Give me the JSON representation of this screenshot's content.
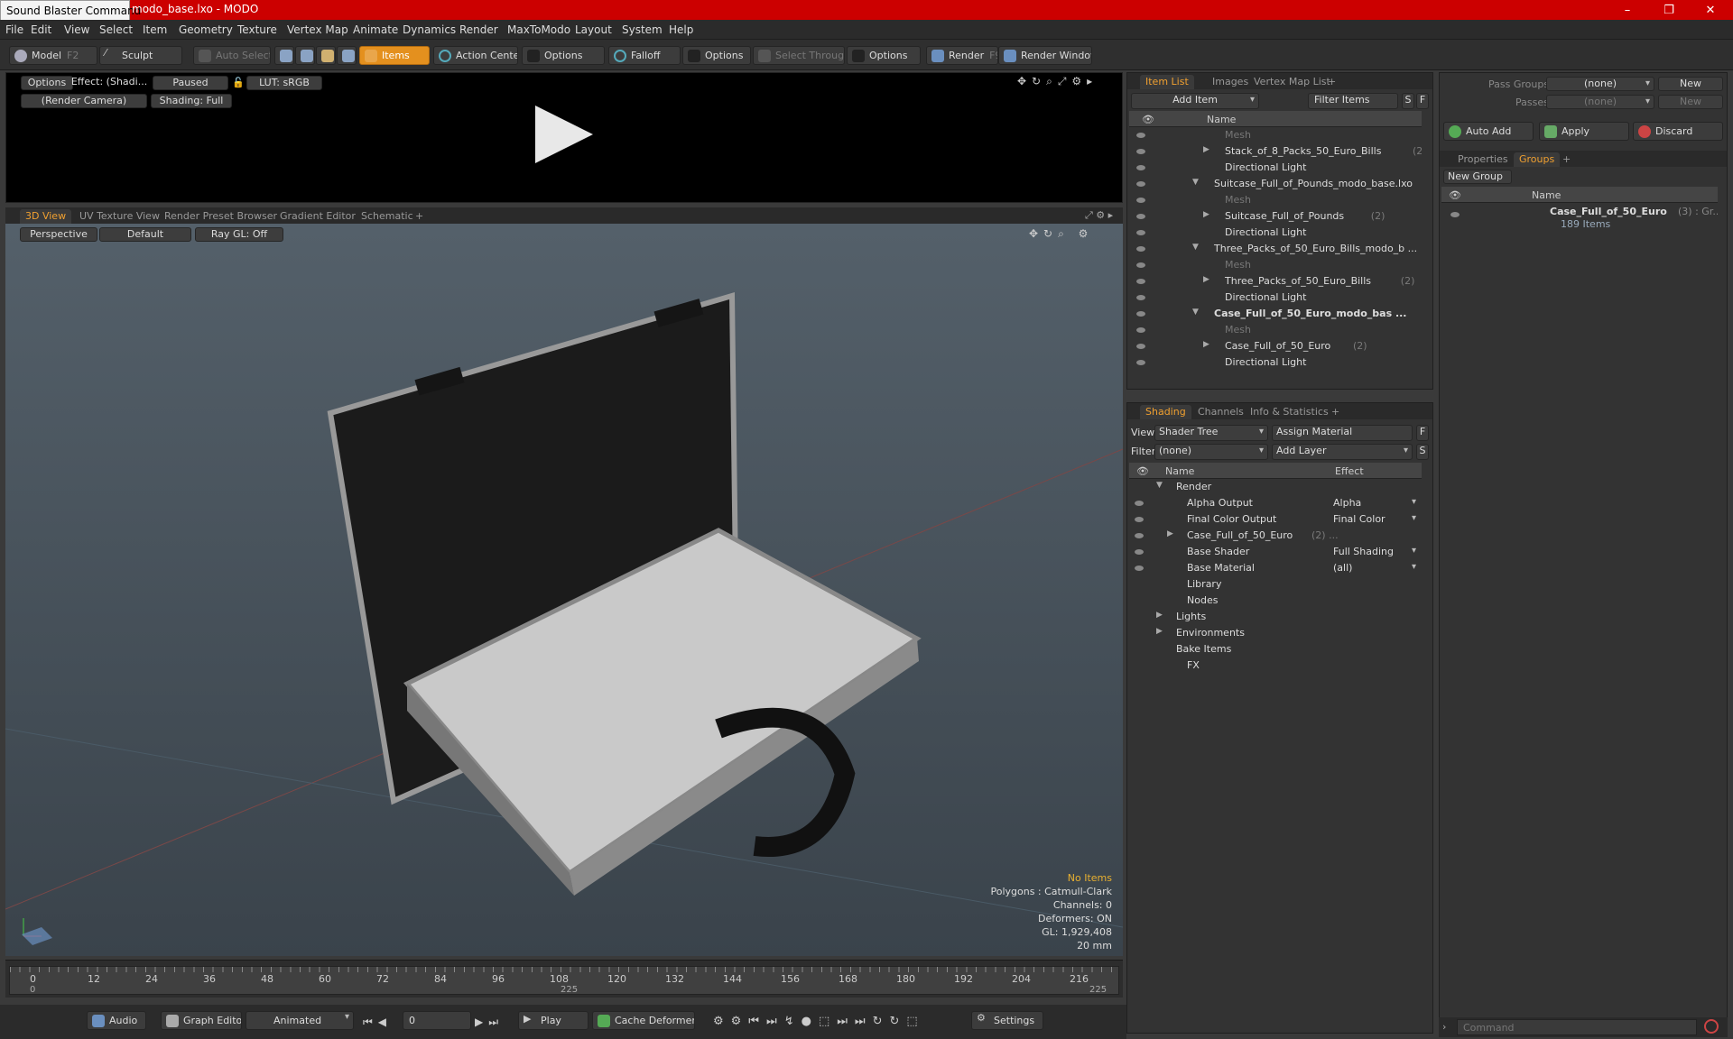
{
  "window": {
    "title": "modo_base.lxo - MODO",
    "tooltip": "Sound Blaster Command",
    "minimize": "–",
    "maximize": "❐",
    "close": "✕"
  },
  "menu": [
    "File",
    "Edit",
    "View",
    "Select",
    "Item",
    "Geometry",
    "Texture",
    "Vertex Map",
    "Animate",
    "Dynamics",
    "Render",
    "MaxToModo",
    "Layout",
    "System",
    "Help"
  ],
  "toolbar": {
    "model": "Model",
    "model_key": "F2",
    "sculpt": "Sculpt",
    "auto_select": "Auto Select",
    "items": "Items",
    "action_center": "Action Center",
    "options1": "Options",
    "falloff": "Falloff",
    "options2": "Options",
    "select_through": "Select Through",
    "options3": "Options",
    "render": "Render",
    "render_key": "F9",
    "render_window": "Render Window"
  },
  "preview": {
    "options": "Options",
    "effect": "Effect: (Shadi...",
    "paused": "Paused",
    "lut": "LUT: sRGB",
    "camera": "(Render Camera)",
    "shading": "Shading: Full"
  },
  "viewport": {
    "tabs": [
      "3D View",
      "UV Texture View",
      "Render Preset Browser",
      "Gradient Editor",
      "Schematic",
      "+"
    ],
    "perspective": "Perspective",
    "default": "Default",
    "raygl": "Ray GL: Off",
    "info": {
      "no_items": "No Items",
      "polygons": "Polygons : Catmull-Clark",
      "channels": "Channels: 0",
      "deformers": "Deformers: ON",
      "gl": "GL: 1,929,408",
      "scale": "20 mm"
    }
  },
  "timeline": {
    "ticks": [
      "0",
      "12",
      "24",
      "36",
      "48",
      "60",
      "72",
      "84",
      "96",
      "108",
      "120",
      "132",
      "144",
      "156",
      "168",
      "180",
      "192",
      "204",
      "216"
    ],
    "start": "0",
    "mid": "225",
    "end": "225"
  },
  "bottombar": {
    "audio": "Audio",
    "graph_editor": "Graph Editor",
    "animated": "Animated",
    "frame": "0",
    "play": "Play",
    "cache": "Cache Deformers",
    "settings": "Settings"
  },
  "itemlist": {
    "tabs": [
      "Item List",
      "Images",
      "Vertex Map List",
      "+"
    ],
    "add_item": "Add Item",
    "filter": "Filter Items",
    "s": "S",
    "f": "F",
    "name_col": "Name",
    "rows": [
      {
        "indent": 1,
        "label": "Mesh",
        "dim": true,
        "arrow": ""
      },
      {
        "indent": 1,
        "label": "Stack_of_8_Packs_50_Euro_Bills",
        "count": "(2)",
        "arrow": "▶"
      },
      {
        "indent": 1,
        "label": "Directional Light",
        "arrow": ""
      },
      {
        "indent": 0,
        "label": "Suitcase_Full_of_Pounds_modo_base.lxo",
        "arrow": "▼"
      },
      {
        "indent": 1,
        "label": "Mesh",
        "dim": true,
        "arrow": ""
      },
      {
        "indent": 1,
        "label": "Suitcase_Full_of_Pounds",
        "count": "(2)",
        "arrow": "▶"
      },
      {
        "indent": 1,
        "label": "Directional Light",
        "arrow": ""
      },
      {
        "indent": 0,
        "label": "Three_Packs_of_50_Euro_Bills_modo_b ...",
        "arrow": "▼"
      },
      {
        "indent": 1,
        "label": "Mesh",
        "dim": true,
        "arrow": ""
      },
      {
        "indent": 1,
        "label": "Three_Packs_of_50_Euro_Bills",
        "count": "(2)",
        "arrow": "▶"
      },
      {
        "indent": 1,
        "label": "Directional Light",
        "arrow": ""
      },
      {
        "indent": 0,
        "label": "Case_Full_of_50_Euro_modo_bas ...",
        "bold": true,
        "arrow": "▼"
      },
      {
        "indent": 1,
        "label": "Mesh",
        "dim": true,
        "arrow": ""
      },
      {
        "indent": 1,
        "label": "Case_Full_of_50_Euro",
        "count": "(2)",
        "arrow": "▶"
      },
      {
        "indent": 1,
        "label": "Directional Light",
        "arrow": ""
      }
    ]
  },
  "shading": {
    "tabs": [
      "Shading",
      "Channels",
      "Info & Statistics",
      "+"
    ],
    "view_label": "View",
    "view_value": "Shader Tree",
    "assign": "Assign Material",
    "f": "F",
    "filter_label": "Filter",
    "filter_value": "(none)",
    "add_layer": "Add Layer",
    "s": "S",
    "name_col": "Name",
    "effect_col": "Effect",
    "rows": [
      {
        "indent": 0,
        "label": "Render",
        "effect": "",
        "arrow": "▼",
        "eye": false
      },
      {
        "indent": 1,
        "label": "Alpha Output",
        "effect": "Alpha",
        "eye": true
      },
      {
        "indent": 1,
        "label": "Final Color Output",
        "effect": "Final Color",
        "eye": true
      },
      {
        "indent": 1,
        "label": "Case_Full_of_50_Euro",
        "count": "(2) ...",
        "effect": "",
        "arrow": "▶",
        "eye": true
      },
      {
        "indent": 1,
        "label": "Base Shader",
        "effect": "Full Shading",
        "eye": true
      },
      {
        "indent": 1,
        "label": "Base Material",
        "effect": "(all)",
        "eye": true
      },
      {
        "indent": 1,
        "label": "Library",
        "effect": "",
        "eye": false
      },
      {
        "indent": 1,
        "label": "Nodes",
        "effect": "",
        "eye": false
      },
      {
        "indent": 0,
        "label": "Lights",
        "effect": "",
        "arrow": "▶",
        "eye": false
      },
      {
        "indent": 0,
        "label": "Environments",
        "effect": "",
        "arrow": "▶",
        "eye": false
      },
      {
        "indent": 0,
        "label": "Bake Items",
        "effect": "",
        "eye": false
      },
      {
        "indent": 1,
        "label": "FX",
        "effect": "",
        "eye": false
      }
    ]
  },
  "groups": {
    "pass_groups": "Pass Groups",
    "pass_value": "(none)",
    "new": "New",
    "passes": "Passes",
    "passes_value": "(none)",
    "new2": "New",
    "auto_add": "Auto Add",
    "apply": "Apply",
    "discard": "Discard",
    "tabs": [
      "Properties",
      "Groups",
      "+"
    ],
    "new_group": "New Group",
    "name_col": "Name",
    "item_name": "Case_Full_of_50_Euro",
    "item_count": "(3) : Gr...",
    "item_sub": "189 Items"
  },
  "command": {
    "placeholder": "Command"
  }
}
